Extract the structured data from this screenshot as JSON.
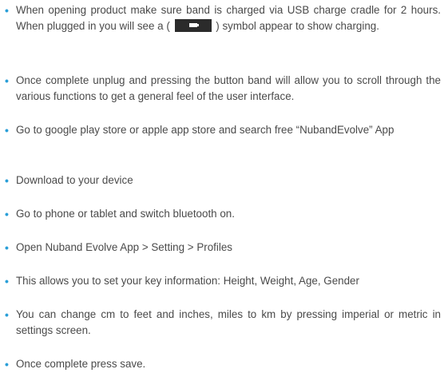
{
  "document": {
    "items": [
      {
        "before": "When opening product make sure band is charged via USB charge cradle for 2 hours. When plugged in you will see a (",
        "icon": "battery-charging-icon",
        "after": ") symbol appear to show charging."
      },
      {
        "text": "Once complete unplug and pressing the button band will allow you to scroll through the various functions to get a general feel of the user interface."
      },
      {
        "text": "Go to google play store or apple app store and search free “NubandEvolve” App"
      },
      {
        "text": "Download to your device"
      },
      {
        "text": "Go to phone or tablet and switch bluetooth on."
      },
      {
        "text": "Open Nuband Evolve App > Setting > Profiles"
      },
      {
        "text": "This allows you to set your key information: Height, Weight, Age, Gender"
      },
      {
        "text": "You can change cm to feet and inches, miles to km by pressing imperial or metric in settings screen."
      },
      {
        "text": "Once complete press save."
      }
    ],
    "bullet_char": "•",
    "accent_color": "#2a9fd8"
  }
}
